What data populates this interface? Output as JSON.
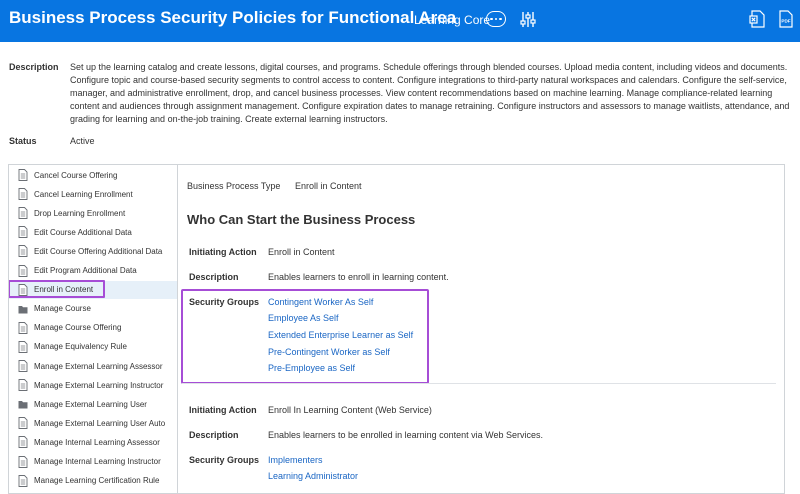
{
  "header": {
    "title": "Business Process Security Policies for Functional Area",
    "app_name": "Learning Core",
    "icons": [
      "more-icon",
      "sliders-icon",
      "export-excel-icon",
      "export-pdf-icon"
    ],
    "color": "#0875e1"
  },
  "description": {
    "label": "Description",
    "text": "Set up the learning catalog and create lessons, digital courses, and programs. Schedule offerings through blended courses. Upload media content, including videos and documents. Configure topic and course-based security segments to control access to content. Configure integrations to third-party natural workspaces and calendars. Configure the self-service, manager, and administrative enrollment, drop, and cancel business processes. View content recommendations based on machine learning. Manage compliance-related learning content and audiences through assignment management. Configure expiration dates to manage retraining. Configure instructors and assessors to manage waitlists, attendance, and grading for learning and on-the-job training. Create external learning instructors."
  },
  "status": {
    "label": "Status",
    "value": "Active"
  },
  "business_processes": [
    {
      "label": "Cancel Course Offering",
      "icon": "document-icon"
    },
    {
      "label": "Cancel Learning Enrollment",
      "icon": "document-icon"
    },
    {
      "label": "Drop Learning Enrollment",
      "icon": "document-icon"
    },
    {
      "label": "Edit Course Additional Data",
      "icon": "document-icon"
    },
    {
      "label": "Edit Course Offering Additional Data",
      "icon": "document-icon"
    },
    {
      "label": "Edit Program Additional Data",
      "icon": "document-icon"
    },
    {
      "label": "Enroll in Content",
      "icon": "document-icon",
      "selected": true
    },
    {
      "label": "Manage Course",
      "icon": "folder-icon"
    },
    {
      "label": "Manage Course Offering",
      "icon": "document-icon"
    },
    {
      "label": "Manage Equivalency Rule",
      "icon": "document-icon"
    },
    {
      "label": "Manage External Learning Assessor",
      "icon": "document-icon"
    },
    {
      "label": "Manage External Learning Instructor",
      "icon": "document-icon"
    },
    {
      "label": "Manage External Learning User",
      "icon": "folder-icon"
    },
    {
      "label": "Manage External Learning User Auto",
      "icon": "document-icon"
    },
    {
      "label": "Manage Internal Learning Assessor",
      "icon": "document-icon"
    },
    {
      "label": "Manage Internal Learning Instructor",
      "icon": "document-icon"
    },
    {
      "label": "Manage Learning Certification Rule",
      "icon": "document-icon"
    }
  ],
  "detail": {
    "bp_type_label": "Business Process Type",
    "bp_type_value": "Enroll in Content",
    "section_title": "Who Can Start the Business Process",
    "entries": [
      {
        "initiating_action_label": "Initiating Action",
        "initiating_action": "Enroll in Content",
        "description_label": "Description",
        "description": "Enables learners to enroll in learning content.",
        "security_groups_label": "Security Groups",
        "security_groups": [
          "Contingent Worker As Self",
          "Employee As Self",
          "Extended Enterprise Learner as Self",
          "Pre-Contingent Worker as Self",
          "Pre-Employee as Self"
        ]
      },
      {
        "initiating_action_label": "Initiating Action",
        "initiating_action": "Enroll In Learning Content (Web Service)",
        "description_label": "Description",
        "description": "Enables learners to be enrolled in learning content via Web Services.",
        "security_groups_label": "Security Groups",
        "security_groups": [
          "Implementers",
          "Learning Administrator"
        ]
      }
    ]
  },
  "colors": {
    "link": "#1a66c4",
    "highlight": "#a64dd6",
    "selected_row": "#e6f0f9"
  }
}
